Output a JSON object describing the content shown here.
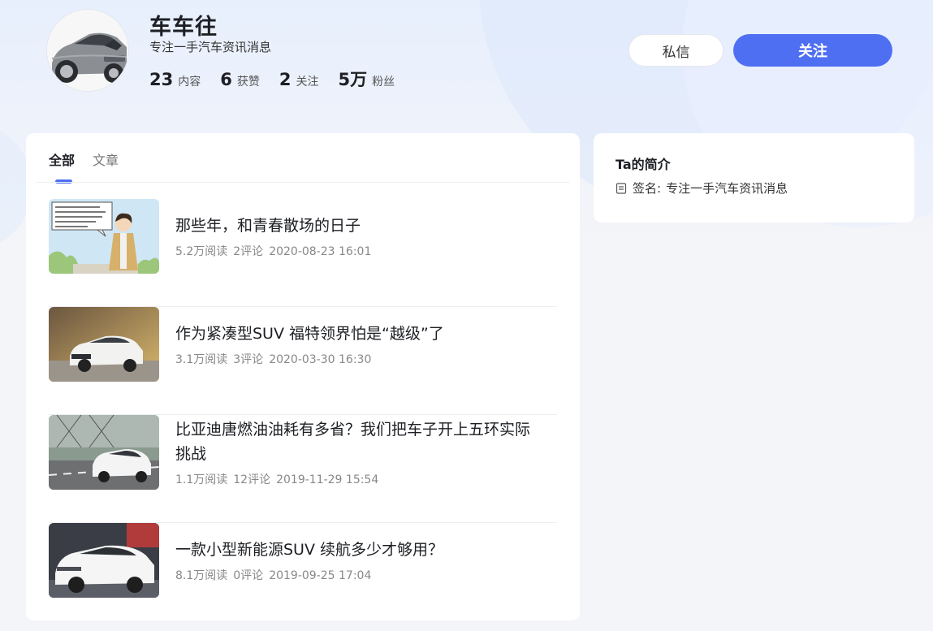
{
  "profile": {
    "name": "车车往",
    "slogan": "专注一手汽车资讯消息",
    "stats": [
      {
        "num": "23",
        "label": "内容"
      },
      {
        "num": "6",
        "label": "获赞"
      },
      {
        "num": "2",
        "label": "关注"
      },
      {
        "num": "5万",
        "label": "粉丝"
      }
    ]
  },
  "actions": {
    "message_label": "私信",
    "follow_label": "关注"
  },
  "tabs": [
    {
      "label": "全部",
      "active": true
    },
    {
      "label": "文章",
      "active": false
    }
  ],
  "articles": [
    {
      "title": "那些年，和青春散场的日子",
      "reads": "5.2万阅读",
      "comments": "2评论",
      "date": "2020-08-23 16:01",
      "thumb": "comic-illustration"
    },
    {
      "title": "作为紧凑型SUV 福特领界怕是“越级”了",
      "reads": "3.1万阅读",
      "comments": "3评论",
      "date": "2020-03-30 16:30",
      "thumb": "white-suv-photo"
    },
    {
      "title": "比亚迪唐燃油油耗有多省？我们把车子开上五环实际挑战",
      "reads": "1.1万阅读",
      "comments": "12评论",
      "date": "2019-11-29 15:54",
      "thumb": "suv-road-photo"
    },
    {
      "title": "一款小型新能源SUV 续航多少才够用？",
      "reads": "8.1万阅读",
      "comments": "0评论",
      "date": "2019-09-25 17:04",
      "thumb": "ev-suv-show-photo"
    }
  ],
  "intro": {
    "title": "Ta的简介",
    "sign_label": "签名:",
    "sign_text": "专注一手汽车资讯消息"
  },
  "colors": {
    "accent": "#4f6ff3",
    "background": "#f4f5f8"
  }
}
